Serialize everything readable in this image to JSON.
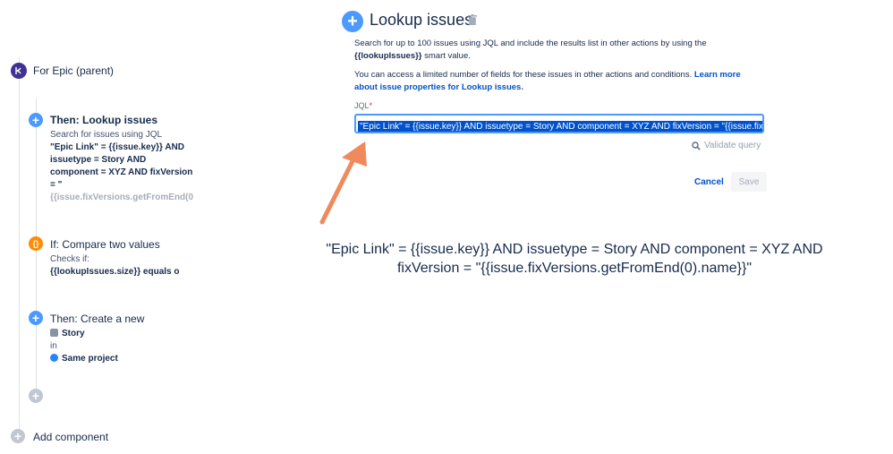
{
  "panel": {
    "title": "Lookup issues",
    "desc1_pre": "Search for up to 100 issues using JQL and include the results list in other actions by using the",
    "desc1_smart": "{{lookupIssues}}",
    "desc1_post": " smart value.",
    "desc2_pre": "You can access a limited number of fields for these issues in other actions and conditions. ",
    "desc2_link": "Learn more about issue properties for Lookup issues.",
    "jql_label": "JQL",
    "jql_required": "*",
    "jql_value": "\"Epic Link\" = {{issue.key}} AND issuetype = Story AND component = XYZ AND fixVersion = \"{{issue.fixVers",
    "validate_label": "Validate query",
    "cancel_label": "Cancel",
    "save_label": "Save"
  },
  "note": {
    "line1": "\"Epic Link\" = {{issue.key}} AND issuetype = Story AND component = XYZ AND",
    "line2": "fixVersion = \"{{issue.fixVersions.getFromEnd(0).name}}\""
  },
  "timeline": {
    "trigger_label": "For Epic (parent)",
    "action1": {
      "title": "Then: Lookup issues",
      "line1": "Search for issues using JQL",
      "line2": "\"Epic Link\" = {{issue.key}} AND",
      "line3": "issuetype = Story AND",
      "line4": "component = XYZ AND fixVersion",
      "line5": "= \"",
      "line6": "{{issue.fixVersions.getFromEnd(0"
    },
    "condition": {
      "title": "If: Compare two values",
      "line1": "Checks if:",
      "line2": "{{lookupIssues.size}} equals o"
    },
    "action2": {
      "title": "Then: Create a new",
      "issue_type": "Story",
      "in_label": "in",
      "project": "Same project"
    },
    "add_component_label": "Add component"
  },
  "colors": {
    "trigger": "#403294",
    "action": "#4c9aff",
    "condition": "#ff8b00",
    "arrow": "#f08a5d",
    "link": "#0052cc"
  }
}
